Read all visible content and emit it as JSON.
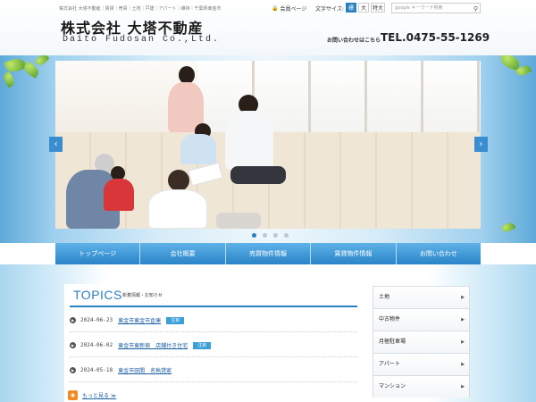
{
  "header": {
    "tagline": "株式会社 大塔不動産｜賃貸｜売買｜土地｜戸建｜アパート｜維持｜千葉県東金市",
    "logo_jp": "株式会社 大塔不動産",
    "logo_en": "Daito Fudosan Co.,Ltd.",
    "member_label": "会員ページ",
    "font_size_label": "文字サイズ:",
    "font_sizes": [
      "標準",
      "大",
      "特大"
    ],
    "search_placeholder": "google キーワード検索",
    "contact_label": "お問い合わせはこちら",
    "contact_tel": "TEL.0475-55-1269"
  },
  "hero": {
    "prev_label": "‹",
    "next_label": "›",
    "slide_count": 4,
    "active_slide": 1
  },
  "nav": {
    "items": [
      "トップページ",
      "会社概要",
      "売買物件情報",
      "賃貸物件情報",
      "お問い合わせ"
    ]
  },
  "topics": {
    "title": "TOPICS",
    "subtitle": "新着情報・お知らせ",
    "items": [
      {
        "date": "2024-06-23",
        "title": "東金市東金市倉庫",
        "badge": "注目"
      },
      {
        "date": "2024-06-02",
        "title": "東金市東新宿　店舗付き住宅",
        "badge": "注目"
      },
      {
        "date": "2024-05-18",
        "title": "東金市田間　名執貸家",
        "badge": ""
      }
    ],
    "more_label": "もっと見る ≫"
  },
  "sidebar": {
    "items": [
      "土地",
      "中古物件",
      "月極駐車場",
      "アパート",
      "マンション"
    ]
  },
  "colors": {
    "accent": "#2a7fbf",
    "nav": "#3a92d4",
    "badge": "#3a9fd8"
  }
}
